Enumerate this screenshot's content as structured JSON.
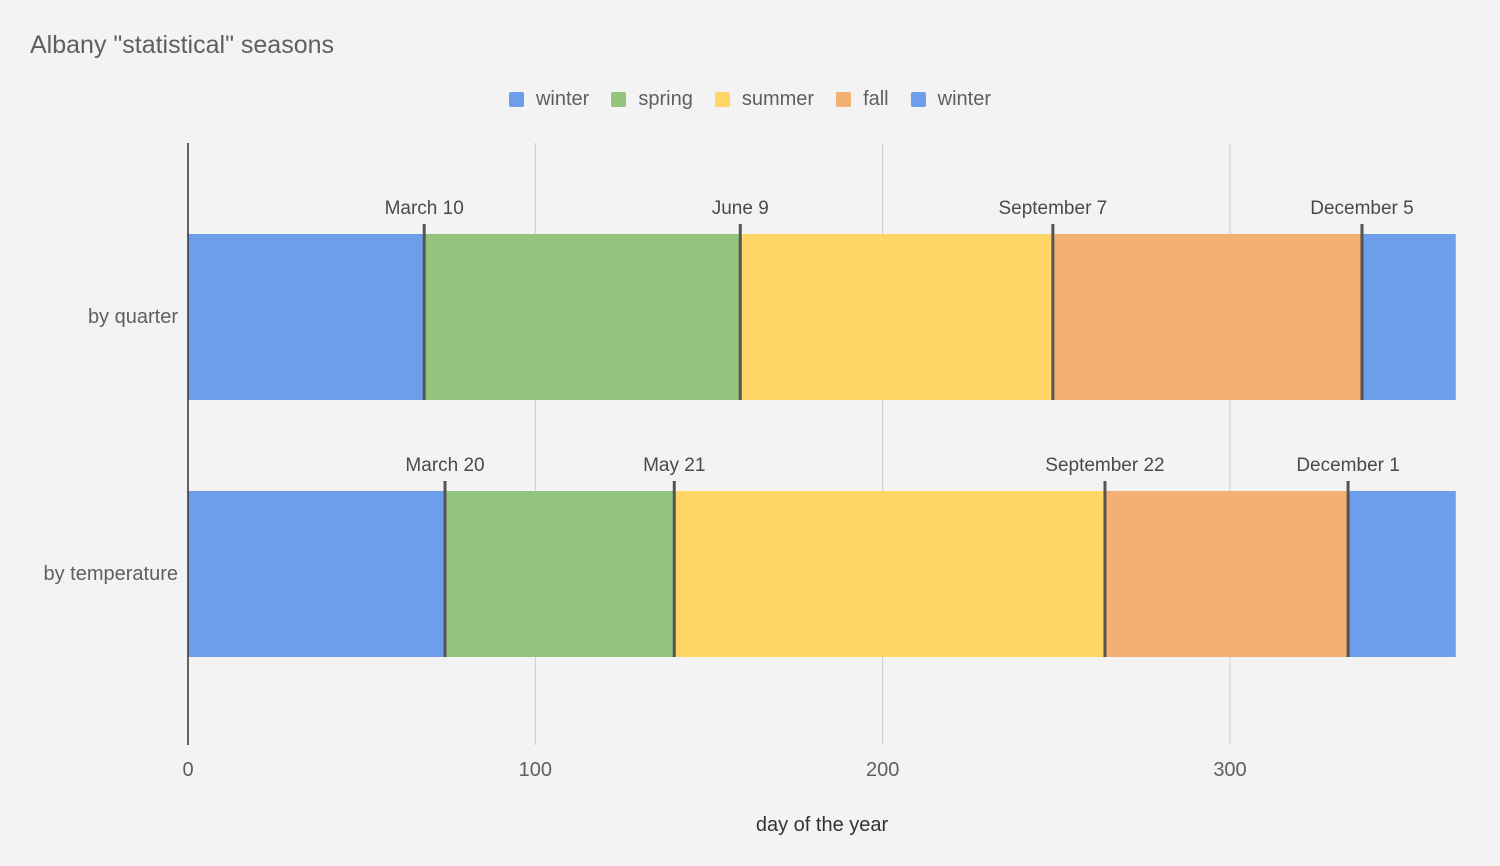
{
  "chart_data": {
    "type": "bar",
    "orientation": "horizontal",
    "stacked": true,
    "title": "Albany \"statistical\" seasons",
    "xlabel": "day of the year",
    "ylabel": "",
    "xlim": [
      0,
      365
    ],
    "x_ticks": [
      0,
      100,
      200,
      300
    ],
    "x_tick_labels": [
      "0",
      "100",
      "200",
      "300"
    ],
    "grid": true,
    "legend_position": "top",
    "categories": [
      "by quarter",
      "by temperature"
    ],
    "series": [
      {
        "name": "winter",
        "color": "#6d9eeb",
        "values": [
          68,
          74
        ]
      },
      {
        "name": "spring",
        "color": "#93c47d",
        "values": [
          91,
          66
        ]
      },
      {
        "name": "summer",
        "color": "#ffd666",
        "values": [
          90,
          124
        ]
      },
      {
        "name": "fall",
        "color": "#f4b074",
        "values": [
          89,
          70
        ]
      },
      {
        "name": "winter",
        "color": "#6d9eeb",
        "values": [
          27,
          31
        ]
      }
    ],
    "annotations": [
      [
        {
          "label": "March 10",
          "x": 68
        },
        {
          "label": "June 9",
          "x": 159
        },
        {
          "label": "September 7",
          "x": 249
        },
        {
          "label": "December 5",
          "x": 338
        }
      ],
      [
        {
          "label": "March 20",
          "x": 74
        },
        {
          "label": "May 21",
          "x": 140
        },
        {
          "label": "September 22",
          "x": 264
        },
        {
          "label": "December 1",
          "x": 334
        }
      ]
    ]
  }
}
